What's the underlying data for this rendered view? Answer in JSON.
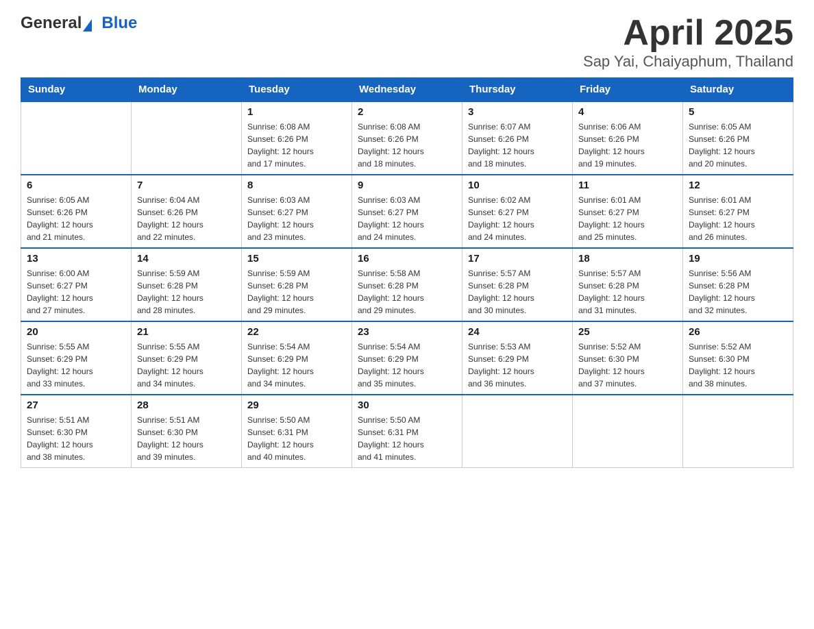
{
  "header": {
    "logo_general": "General",
    "logo_blue": "Blue",
    "title": "April 2025",
    "subtitle": "Sap Yai, Chaiyaphum, Thailand"
  },
  "calendar": {
    "days_of_week": [
      "Sunday",
      "Monday",
      "Tuesday",
      "Wednesday",
      "Thursday",
      "Friday",
      "Saturday"
    ],
    "weeks": [
      [
        {
          "day": "",
          "info": ""
        },
        {
          "day": "",
          "info": ""
        },
        {
          "day": "1",
          "info": "Sunrise: 6:08 AM\nSunset: 6:26 PM\nDaylight: 12 hours\nand 17 minutes."
        },
        {
          "day": "2",
          "info": "Sunrise: 6:08 AM\nSunset: 6:26 PM\nDaylight: 12 hours\nand 18 minutes."
        },
        {
          "day": "3",
          "info": "Sunrise: 6:07 AM\nSunset: 6:26 PM\nDaylight: 12 hours\nand 18 minutes."
        },
        {
          "day": "4",
          "info": "Sunrise: 6:06 AM\nSunset: 6:26 PM\nDaylight: 12 hours\nand 19 minutes."
        },
        {
          "day": "5",
          "info": "Sunrise: 6:05 AM\nSunset: 6:26 PM\nDaylight: 12 hours\nand 20 minutes."
        }
      ],
      [
        {
          "day": "6",
          "info": "Sunrise: 6:05 AM\nSunset: 6:26 PM\nDaylight: 12 hours\nand 21 minutes."
        },
        {
          "day": "7",
          "info": "Sunrise: 6:04 AM\nSunset: 6:26 PM\nDaylight: 12 hours\nand 22 minutes."
        },
        {
          "day": "8",
          "info": "Sunrise: 6:03 AM\nSunset: 6:27 PM\nDaylight: 12 hours\nand 23 minutes."
        },
        {
          "day": "9",
          "info": "Sunrise: 6:03 AM\nSunset: 6:27 PM\nDaylight: 12 hours\nand 24 minutes."
        },
        {
          "day": "10",
          "info": "Sunrise: 6:02 AM\nSunset: 6:27 PM\nDaylight: 12 hours\nand 24 minutes."
        },
        {
          "day": "11",
          "info": "Sunrise: 6:01 AM\nSunset: 6:27 PM\nDaylight: 12 hours\nand 25 minutes."
        },
        {
          "day": "12",
          "info": "Sunrise: 6:01 AM\nSunset: 6:27 PM\nDaylight: 12 hours\nand 26 minutes."
        }
      ],
      [
        {
          "day": "13",
          "info": "Sunrise: 6:00 AM\nSunset: 6:27 PM\nDaylight: 12 hours\nand 27 minutes."
        },
        {
          "day": "14",
          "info": "Sunrise: 5:59 AM\nSunset: 6:28 PM\nDaylight: 12 hours\nand 28 minutes."
        },
        {
          "day": "15",
          "info": "Sunrise: 5:59 AM\nSunset: 6:28 PM\nDaylight: 12 hours\nand 29 minutes."
        },
        {
          "day": "16",
          "info": "Sunrise: 5:58 AM\nSunset: 6:28 PM\nDaylight: 12 hours\nand 29 minutes."
        },
        {
          "day": "17",
          "info": "Sunrise: 5:57 AM\nSunset: 6:28 PM\nDaylight: 12 hours\nand 30 minutes."
        },
        {
          "day": "18",
          "info": "Sunrise: 5:57 AM\nSunset: 6:28 PM\nDaylight: 12 hours\nand 31 minutes."
        },
        {
          "day": "19",
          "info": "Sunrise: 5:56 AM\nSunset: 6:28 PM\nDaylight: 12 hours\nand 32 minutes."
        }
      ],
      [
        {
          "day": "20",
          "info": "Sunrise: 5:55 AM\nSunset: 6:29 PM\nDaylight: 12 hours\nand 33 minutes."
        },
        {
          "day": "21",
          "info": "Sunrise: 5:55 AM\nSunset: 6:29 PM\nDaylight: 12 hours\nand 34 minutes."
        },
        {
          "day": "22",
          "info": "Sunrise: 5:54 AM\nSunset: 6:29 PM\nDaylight: 12 hours\nand 34 minutes."
        },
        {
          "day": "23",
          "info": "Sunrise: 5:54 AM\nSunset: 6:29 PM\nDaylight: 12 hours\nand 35 minutes."
        },
        {
          "day": "24",
          "info": "Sunrise: 5:53 AM\nSunset: 6:29 PM\nDaylight: 12 hours\nand 36 minutes."
        },
        {
          "day": "25",
          "info": "Sunrise: 5:52 AM\nSunset: 6:30 PM\nDaylight: 12 hours\nand 37 minutes."
        },
        {
          "day": "26",
          "info": "Sunrise: 5:52 AM\nSunset: 6:30 PM\nDaylight: 12 hours\nand 38 minutes."
        }
      ],
      [
        {
          "day": "27",
          "info": "Sunrise: 5:51 AM\nSunset: 6:30 PM\nDaylight: 12 hours\nand 38 minutes."
        },
        {
          "day": "28",
          "info": "Sunrise: 5:51 AM\nSunset: 6:30 PM\nDaylight: 12 hours\nand 39 minutes."
        },
        {
          "day": "29",
          "info": "Sunrise: 5:50 AM\nSunset: 6:31 PM\nDaylight: 12 hours\nand 40 minutes."
        },
        {
          "day": "30",
          "info": "Sunrise: 5:50 AM\nSunset: 6:31 PM\nDaylight: 12 hours\nand 41 minutes."
        },
        {
          "day": "",
          "info": ""
        },
        {
          "day": "",
          "info": ""
        },
        {
          "day": "",
          "info": ""
        }
      ]
    ]
  }
}
